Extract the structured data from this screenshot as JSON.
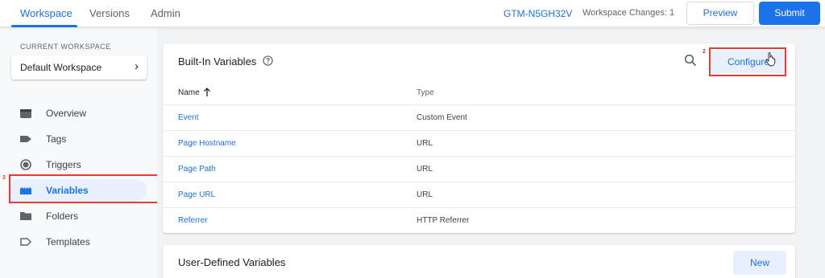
{
  "header": {
    "tabs": [
      {
        "label": "Workspace",
        "active": true
      },
      {
        "label": "Versions",
        "active": false
      },
      {
        "label": "Admin",
        "active": false
      }
    ],
    "container_id": "GTM-N5GH32V",
    "workspace_changes": "Workspace Changes: 1",
    "preview_label": "Preview",
    "submit_label": "Submit"
  },
  "sidebar": {
    "current_workspace_label": "CURRENT WORKSPACE",
    "workspace_name": "Default Workspace",
    "items": [
      {
        "label": "Overview",
        "icon": "overview-icon",
        "selected": false
      },
      {
        "label": "Tags",
        "icon": "tag-icon",
        "selected": false
      },
      {
        "label": "Triggers",
        "icon": "trigger-icon",
        "selected": false
      },
      {
        "label": "Variables",
        "icon": "variables-icon",
        "selected": true
      },
      {
        "label": "Folders",
        "icon": "folder-icon",
        "selected": false
      },
      {
        "label": "Templates",
        "icon": "template-icon",
        "selected": false
      }
    ]
  },
  "builtin": {
    "title": "Built-In Variables",
    "configure_label": "Configure",
    "columns": {
      "name": "Name",
      "type": "Type"
    },
    "rows": [
      {
        "name": "Event",
        "type": "Custom Event"
      },
      {
        "name": "Page Hostname",
        "type": "URL"
      },
      {
        "name": "Page Path",
        "type": "URL"
      },
      {
        "name": "Page URL",
        "type": "URL"
      },
      {
        "name": "Referrer",
        "type": "HTTP Referrer"
      }
    ]
  },
  "user_defined": {
    "title": "User-Defined Variables",
    "new_label": "New"
  },
  "annotations": {
    "step_variables": "3",
    "step_configure": "2"
  },
  "colors": {
    "accent": "#1a73e8",
    "highlight": "#e53935"
  }
}
